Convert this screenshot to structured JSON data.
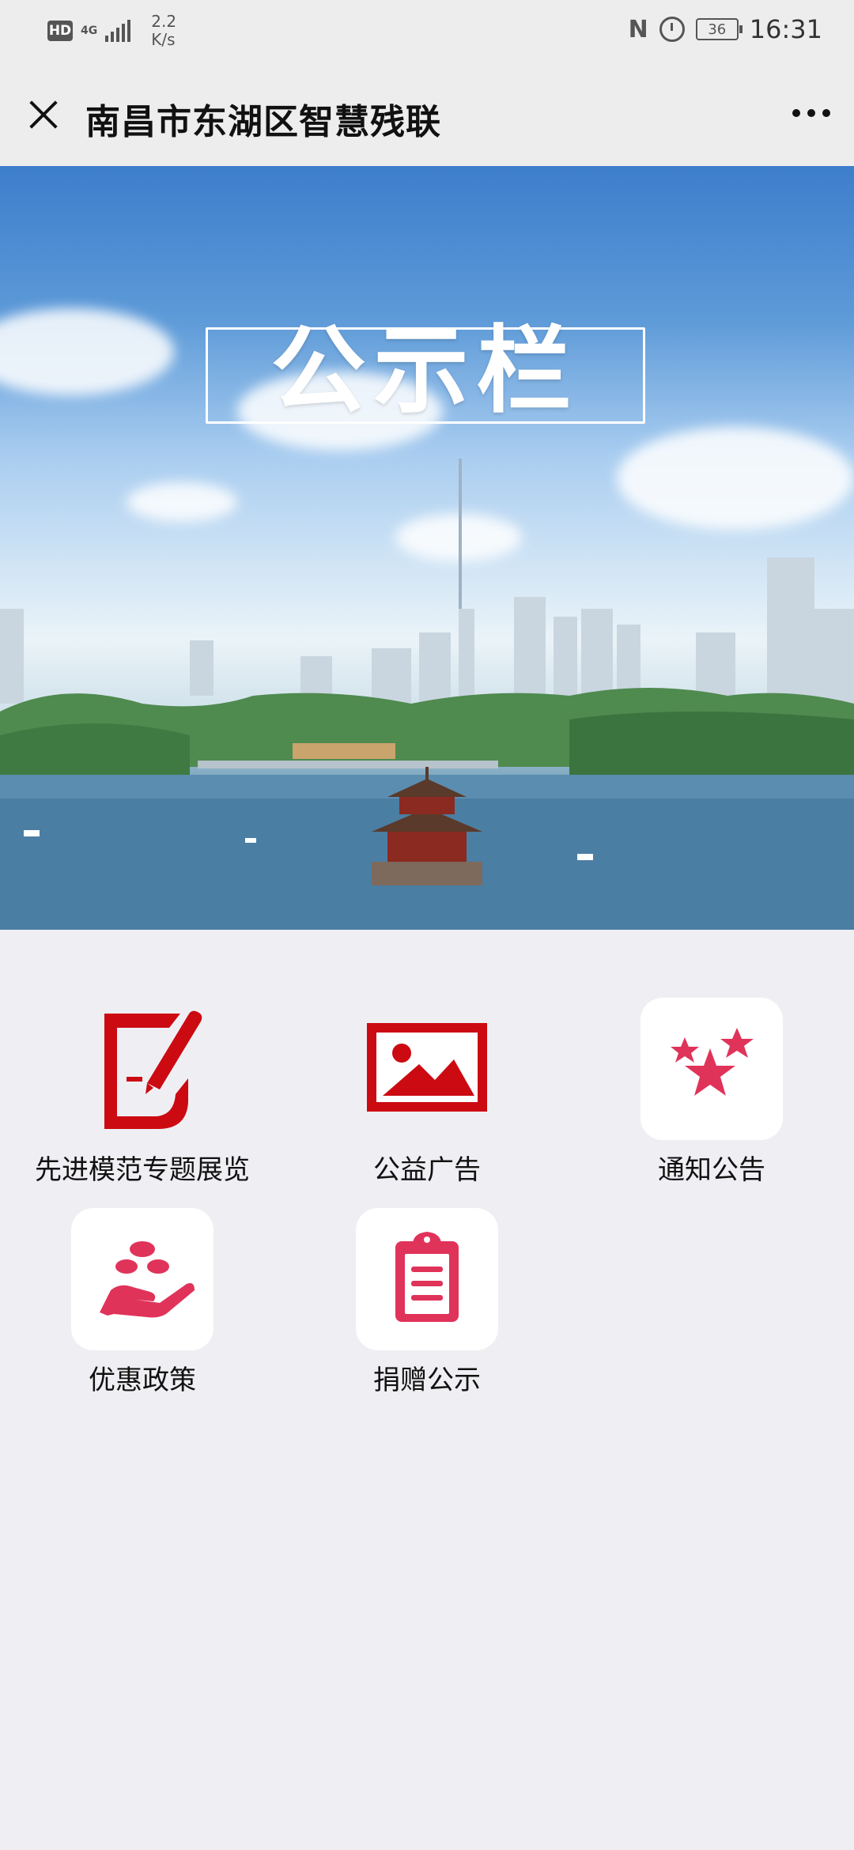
{
  "status_bar": {
    "hd": "HD",
    "network": "4G",
    "speed_value": "2.2",
    "speed_unit": "K/s",
    "battery": "36",
    "time": "16:31"
  },
  "nav": {
    "title": "南昌市东湖区智慧残联"
  },
  "banner": {
    "title": "公示栏"
  },
  "menu": [
    {
      "label": "先进模范专题展览",
      "icon": "pen-document-icon"
    },
    {
      "label": "公益广告",
      "icon": "picture-icon"
    },
    {
      "label": "通知公告",
      "icon": "stars-icon"
    },
    {
      "label": "优惠政策",
      "icon": "helping-hand-icon"
    },
    {
      "label": "捐赠公示",
      "icon": "clipboard-icon"
    }
  ],
  "colors": {
    "accent": "#e0335a",
    "deep_red": "#cc0a12",
    "page_bg": "#efeff3",
    "header_bg": "#ededed"
  }
}
